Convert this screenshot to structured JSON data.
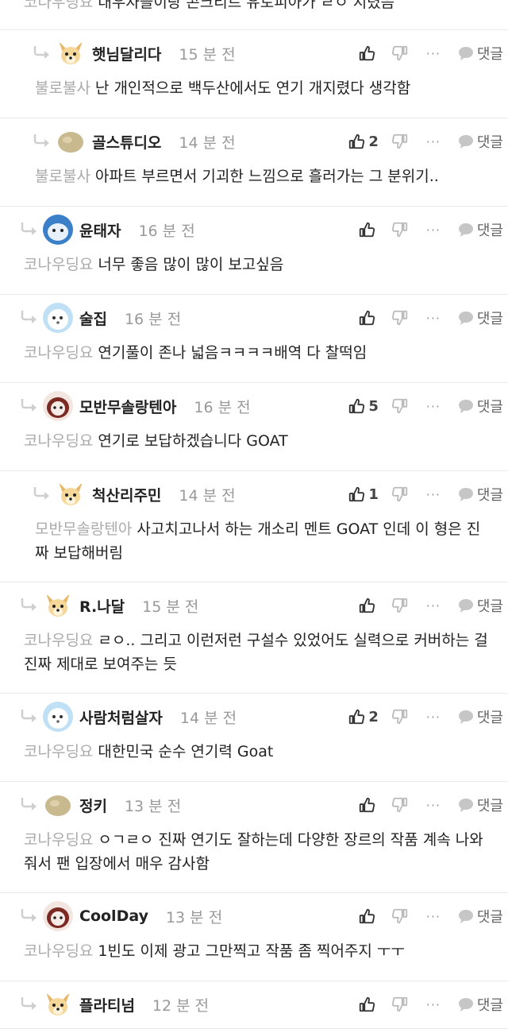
{
  "top_partial": {
    "mention": "코나우딩요",
    "text": "대우자들이랑 콘크리트 유토피아가 ㄹㅇ 지렸음"
  },
  "comments": [
    {
      "name": "햇님달리다",
      "time": "15 분 전",
      "likes": "",
      "mention": "불로불사",
      "text": "난 개인적으로 백두산에서도 연기 개지렸다 생각함",
      "nested": true,
      "avatar": "fox"
    },
    {
      "name": "골스튜디오",
      "time": "14 분 전",
      "likes": "2",
      "mention": "불로불사",
      "text": "아파트 부르면서 기괴한 느낌으로 흘러가는 그 분위기..",
      "nested": true,
      "avatar": "tan"
    },
    {
      "name": "윤태자",
      "time": "16 분 전",
      "likes": "",
      "mention": "코나우딩요",
      "text": "너무 좋음 많이 많이 보고싶음",
      "nested": false,
      "avatar": "blue"
    },
    {
      "name": "술집",
      "time": "16 분 전",
      "likes": "",
      "mention": "코나우딩요",
      "text": "연기풀이 존나 넓음ㅋㅋㅋㅋ배역 다 찰떡임",
      "nested": false,
      "avatar": "white"
    },
    {
      "name": "모반무솔랑텐아",
      "time": "16 분 전",
      "likes": "5",
      "mention": "코나우딩요",
      "text": "연기로 보답하겠습니다 GOAT",
      "nested": false,
      "avatar": "brown"
    },
    {
      "name": "척산리주민",
      "time": "14 분 전",
      "likes": "1",
      "mention": "모반무솔랑텐아",
      "text": "사고치고나서 하는 개소리 멘트 GOAT 인데 이 형은 진짜 보답해버림",
      "nested": true,
      "avatar": "fox"
    },
    {
      "name": "R.나달",
      "time": "15 분 전",
      "likes": "",
      "mention": "코나우딩요",
      "text": "ㄹㅇ.. 그리고 이런저런 구설수 있었어도 실력으로 커버하는 걸 진짜 제대로 보여주는 듯",
      "nested": false,
      "avatar": "fox"
    },
    {
      "name": "사람처럼살자",
      "time": "14 분 전",
      "likes": "2",
      "mention": "코나우딩요",
      "text": "대한민국 순수 연기력 Goat",
      "nested": false,
      "avatar": "white"
    },
    {
      "name": "정키",
      "time": "13 분 전",
      "likes": "",
      "mention": "코나우딩요",
      "text": "ㅇㄱㄹㅇ 진짜 연기도 잘하는데 다양한 장르의 작품 계속 나와줘서 팬 입장에서 매우 감사함",
      "nested": false,
      "avatar": "tan"
    },
    {
      "name": "CoolDay",
      "time": "13 분 전",
      "likes": "",
      "mention": "코나우딩요",
      "text": "1빈도 이제 광고 그만찍고 작품 좀 찍어주지 ㅜㅜ",
      "nested": false,
      "avatar": "brown"
    },
    {
      "name": "플라티넘",
      "time": "12 분 전",
      "likes": "",
      "mention": "",
      "text": "",
      "nested": false,
      "avatar": "fox"
    }
  ],
  "labels": {
    "reply": "댓글",
    "more": "···"
  },
  "colors": {
    "name": "#222222",
    "time": "#999999",
    "mention": "#aaaaaa",
    "divider": "#e9e9e9"
  }
}
